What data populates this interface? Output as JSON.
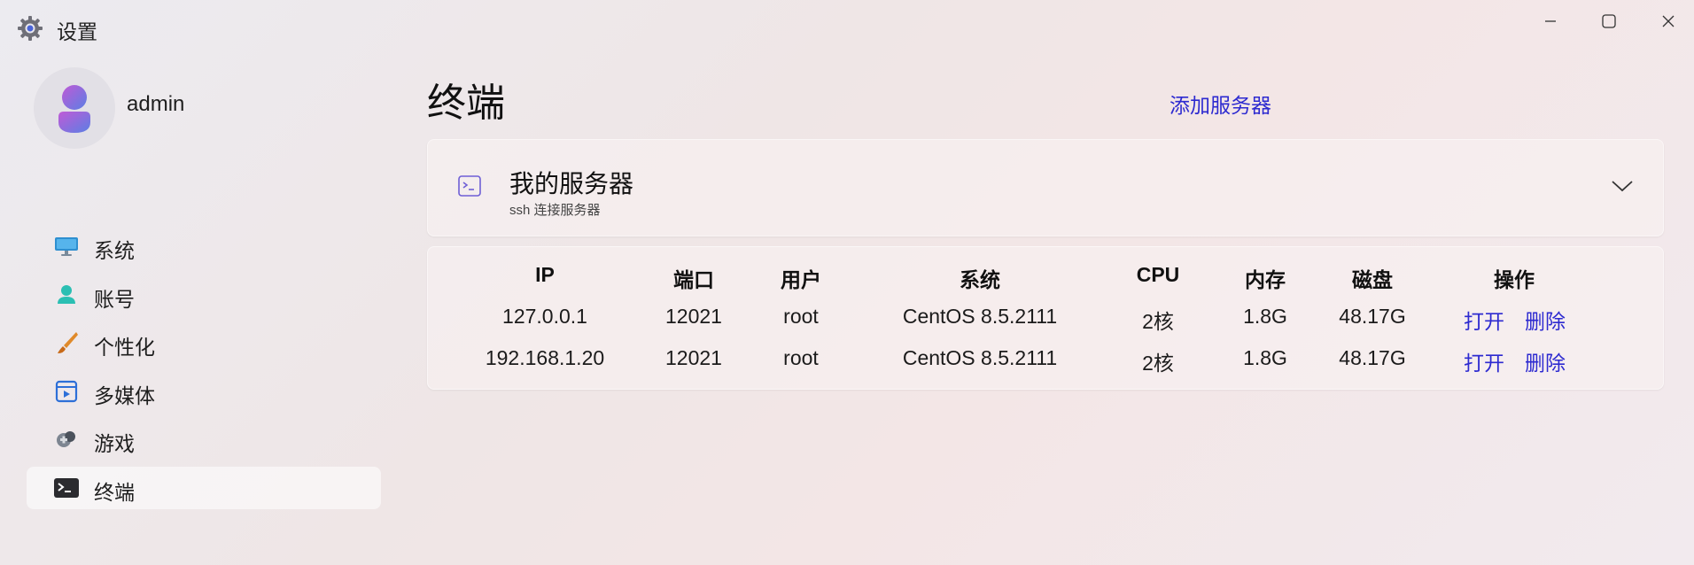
{
  "window": {
    "title": "设置"
  },
  "profile": {
    "username": "admin"
  },
  "sidebar": {
    "items": [
      {
        "label": "系统",
        "icon": "monitor-icon"
      },
      {
        "label": "账号",
        "icon": "account-icon"
      },
      {
        "label": "个性化",
        "icon": "brush-icon"
      },
      {
        "label": "多媒体",
        "icon": "media-icon"
      },
      {
        "label": "游戏",
        "icon": "gamepad-icon"
      },
      {
        "label": "终端",
        "icon": "terminal-icon",
        "active": true
      }
    ]
  },
  "main": {
    "title": "终端",
    "add_server_label": "添加服务器",
    "card": {
      "title": "我的服务器",
      "subtitle": "ssh 连接服务器"
    },
    "table": {
      "headers": [
        "IP",
        "端口",
        "用户",
        "系统",
        "CPU",
        "内存",
        "磁盘",
        "操作"
      ],
      "rows": [
        {
          "ip": "127.0.0.1",
          "port": "12021",
          "user": "root",
          "os": "CentOS 8.5.2111",
          "cpu": "2核",
          "memory": "1.8G",
          "disk": "48.17G",
          "open": "打开",
          "delete": "删除"
        },
        {
          "ip": "192.168.1.20",
          "port": "12021",
          "user": "root",
          "os": "CentOS 8.5.2111",
          "cpu": "2核",
          "memory": "1.8G",
          "disk": "48.17G",
          "open": "打开",
          "delete": "删除"
        }
      ]
    }
  },
  "colors": {
    "accent": "#2d2ad0",
    "background": "#efe7e8"
  }
}
